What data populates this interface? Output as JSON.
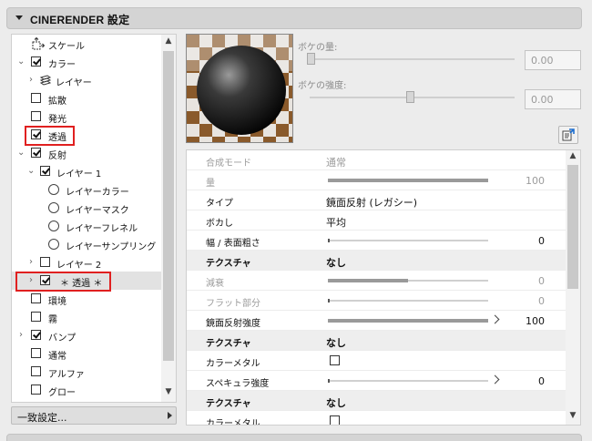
{
  "header": {
    "title": "CINERENDER 設定"
  },
  "tree": {
    "items": [
      {
        "label": "スケール",
        "icon": "scale-icon"
      },
      {
        "label": "カラー",
        "checked": true,
        "expanded": true
      },
      {
        "label": "レイヤー",
        "icon": "layers-icon",
        "collapsed": true
      },
      {
        "label": "拡散",
        "checked": false
      },
      {
        "label": "発光",
        "checked": false
      },
      {
        "label": "透過",
        "checked": true,
        "highlighted": true
      },
      {
        "label": "反射",
        "checked": true,
        "expanded": true
      },
      {
        "label": "レイヤー 1",
        "checked": true,
        "expanded": true
      },
      {
        "label": "レイヤーカラー"
      },
      {
        "label": "レイヤーマスク"
      },
      {
        "label": "レイヤーフレネル"
      },
      {
        "label": "レイヤーサンプリング"
      },
      {
        "label": "レイヤー 2",
        "checked": false,
        "collapsed": true
      },
      {
        "label": "＊ 透過 ＊",
        "checked": true,
        "collapsed": true,
        "selected": true,
        "highlighted": true
      },
      {
        "label": "環境",
        "checked": false
      },
      {
        "label": "霧",
        "checked": false
      },
      {
        "label": "バンプ",
        "checked": true,
        "collapsed": true
      },
      {
        "label": "通常",
        "checked": false
      },
      {
        "label": "アルファ",
        "checked": false
      },
      {
        "label": "グロー",
        "checked": false
      }
    ]
  },
  "match_button": {
    "label": "一致設定..."
  },
  "preview": {
    "bokeh_amount": {
      "label": "ボケの量:",
      "value": "0.00"
    },
    "bokeh_strength": {
      "label": "ボケの強度:",
      "value": "0.00"
    }
  },
  "properties": {
    "rows": [
      {
        "key": "合成モード",
        "value": "通常",
        "dim": true
      },
      {
        "key": "量",
        "slider": 1.0,
        "num": "100",
        "dim": true
      },
      {
        "key": "タイプ",
        "value": "鏡面反射 (レガシー)"
      },
      {
        "key": "ボカし",
        "value": "平均"
      },
      {
        "key": "幅 / 表面粗さ",
        "slider": 0.0,
        "num": "0"
      },
      {
        "key": "テクスチャ",
        "value": "なし",
        "section": true
      },
      {
        "key": "減衰",
        "slider": 0.5,
        "num": "0",
        "dim": true
      },
      {
        "key": "フラット部分",
        "slider": 0.0,
        "num": "0",
        "dim": true
      },
      {
        "key": "鏡面反射強度",
        "slider": 1.0,
        "num": "100",
        "arrow": true
      },
      {
        "key": "テクスチャ",
        "value": "なし",
        "section": true
      },
      {
        "key": "カラーメタル",
        "checkbox": false
      },
      {
        "key": "スペキュラ強度",
        "slider": 0.0,
        "num": "0",
        "arrow": true
      },
      {
        "key": "テクスチャ",
        "value": "なし",
        "section": true
      },
      {
        "key": "カラーメタル",
        "checkbox": false
      }
    ]
  },
  "colors": {
    "highlight": "#e02020",
    "selected_row": "#e2e2e2"
  }
}
